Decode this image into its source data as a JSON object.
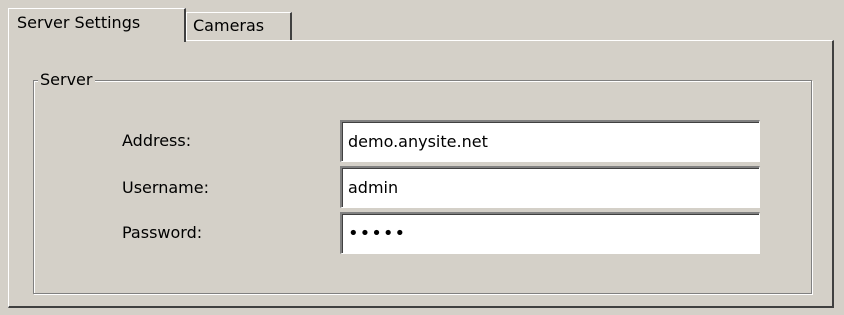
{
  "tabs": [
    {
      "label": "Server Settings",
      "active": true
    },
    {
      "label": "Cameras",
      "active": false
    }
  ],
  "server_group": {
    "title": "Server",
    "fields": [
      {
        "label": "Address:",
        "value": "demo.anysite.net",
        "type": "text"
      },
      {
        "label": "Username:",
        "value": "admin",
        "type": "text"
      },
      {
        "label": "Password:",
        "value": "•••••",
        "type": "password"
      }
    ]
  },
  "colors": {
    "background": "#d4d0c8",
    "highlight": "#ffffff",
    "shadow": "#808080",
    "dark_shadow": "#404040",
    "input_background": "#ffffff"
  }
}
